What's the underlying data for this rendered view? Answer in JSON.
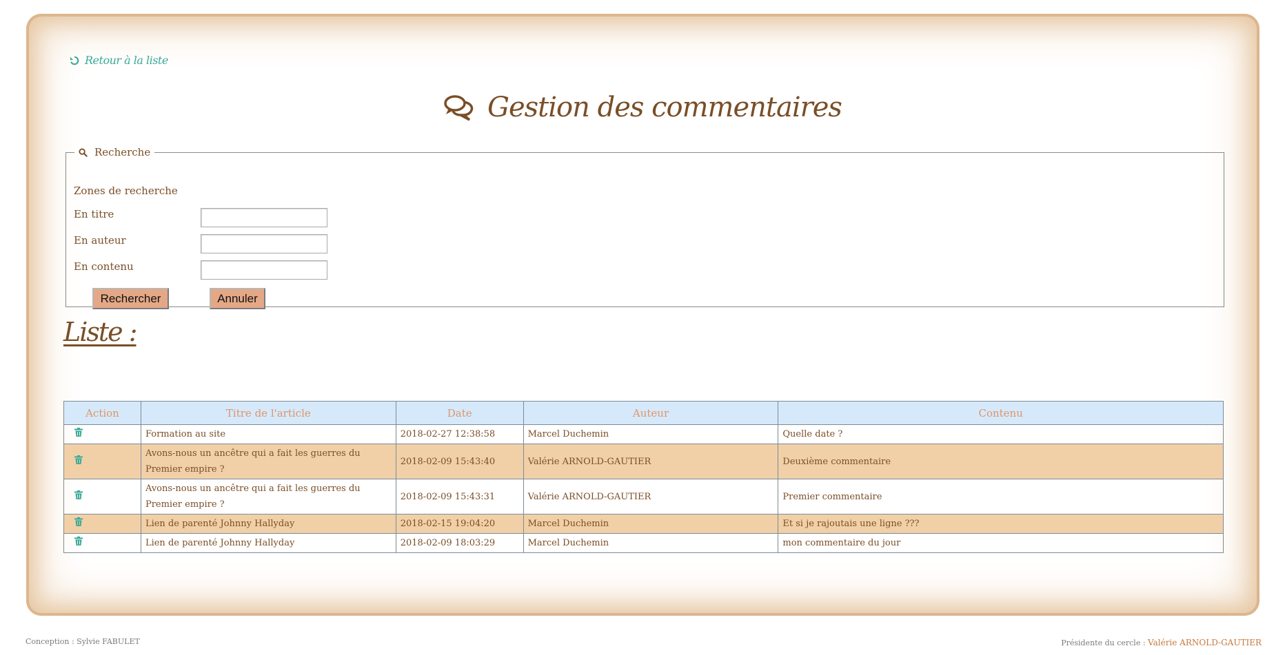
{
  "nav": {
    "back_label": "Retour à la liste",
    "back_icon": "undo-icon"
  },
  "page": {
    "title": "Gestion des commentaires",
    "title_icon": "comments-icon"
  },
  "search": {
    "legend": "Recherche",
    "legend_icon": "search-icon",
    "zones_label": "Zones de recherche",
    "fields": [
      {
        "label": "En titre",
        "value": ""
      },
      {
        "label": "En auteur",
        "value": ""
      },
      {
        "label": "En contenu",
        "value": ""
      }
    ],
    "search_button": "Rechercher",
    "cancel_button": "Annuler"
  },
  "list": {
    "heading": "Liste :",
    "columns": [
      "Action",
      "Titre de l'article",
      "Date",
      "Auteur",
      "Contenu"
    ],
    "rows": [
      {
        "title": "Formation au site",
        "date": "2018-02-27 12:38:58",
        "author": "Marcel Duchemin",
        "content": "Quelle date ?"
      },
      {
        "title": "Avons-nous un ancêtre qui a fait les guerres du Premier empire ?",
        "date": "2018-02-09 15:43:40",
        "author": "Valérie ARNOLD-GAUTIER",
        "content": "Deuxième commentaire"
      },
      {
        "title": "Avons-nous un ancêtre qui a fait les guerres du Premier empire ?",
        "date": "2018-02-09 15:43:31",
        "author": "Valérie ARNOLD-GAUTIER",
        "content": "Premier commentaire"
      },
      {
        "title": "Lien de parenté Johnny Hallyday",
        "date": "2018-02-15 19:04:20",
        "author": "Marcel Duchemin",
        "content": "Et si je rajoutais une ligne ???"
      },
      {
        "title": "Lien de parenté Johnny Hallyday",
        "date": "2018-02-09 18:03:29",
        "author": "Marcel Duchemin",
        "content": "mon commentaire du jour"
      }
    ],
    "action_icon": "trash-icon"
  },
  "footer": {
    "left": "Conception : Sylvie FABULET",
    "right_prefix": "Présidente du cercle : ",
    "right_name": "Valérie ARNOLD-GAUTIER"
  },
  "colors": {
    "brown": "#7a4e27",
    "teal": "#3aaa98",
    "header_bg": "#d5e9fa",
    "header_text": "#e0956a",
    "alt_row": "#f1d0a8",
    "button": "#e4a886"
  }
}
